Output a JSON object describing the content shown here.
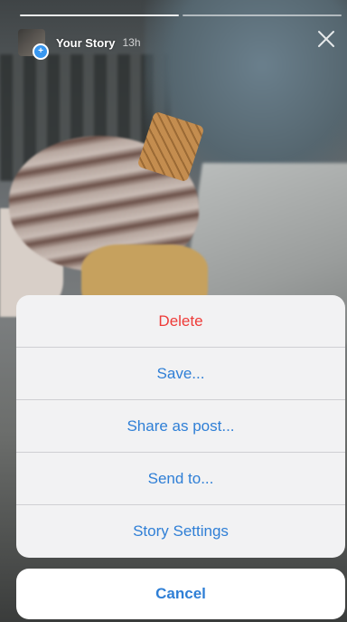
{
  "story": {
    "owner": "Your Story",
    "time": "13h",
    "progress_segments": 2,
    "active_segment": 1
  },
  "action_sheet": {
    "items": [
      {
        "label": "Delete",
        "style": "destructive"
      },
      {
        "label": "Save...",
        "style": "default"
      },
      {
        "label": "Share as post...",
        "style": "default"
      },
      {
        "label": "Send to...",
        "style": "default"
      },
      {
        "label": "Story Settings",
        "style": "default"
      }
    ],
    "cancel_label": "Cancel"
  },
  "colors": {
    "action_blue": "#2f7fd6",
    "destructive_red": "#ee3b38",
    "badge_blue": "#3897f0"
  },
  "icons": {
    "close": "close-icon",
    "add": "plus-icon"
  }
}
